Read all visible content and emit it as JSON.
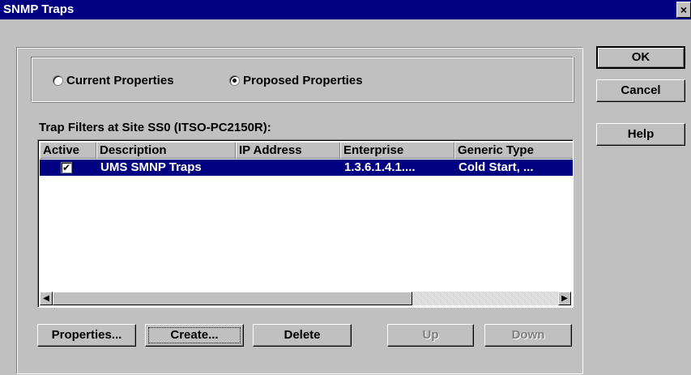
{
  "window": {
    "title": "SNMP Traps",
    "close": "×"
  },
  "view": {
    "current": "Current Properties",
    "proposed": "Proposed Properties",
    "selected": "proposed"
  },
  "list": {
    "label": "Trap Filters at Site SS0 (ITSO-PC2150R):",
    "columns": [
      "Active",
      "Description",
      "IP Address",
      "Enterprise",
      "Generic Type"
    ],
    "rows": [
      {
        "active": true,
        "description": "UMS SMNP Traps",
        "ip_address": "",
        "enterprise": "1.3.6.1.4.1....",
        "generic_type": "Cold Start, ..."
      }
    ]
  },
  "buttons": {
    "properties": "Properties...",
    "create": "Create...",
    "delete": "Delete",
    "up": "Up",
    "down": "Down",
    "ok": "OK",
    "cancel": "Cancel",
    "help": "Help"
  },
  "icons": {
    "check": "checkmark-icon",
    "left": "arrow-left-icon",
    "right": "arrow-right-icon"
  }
}
